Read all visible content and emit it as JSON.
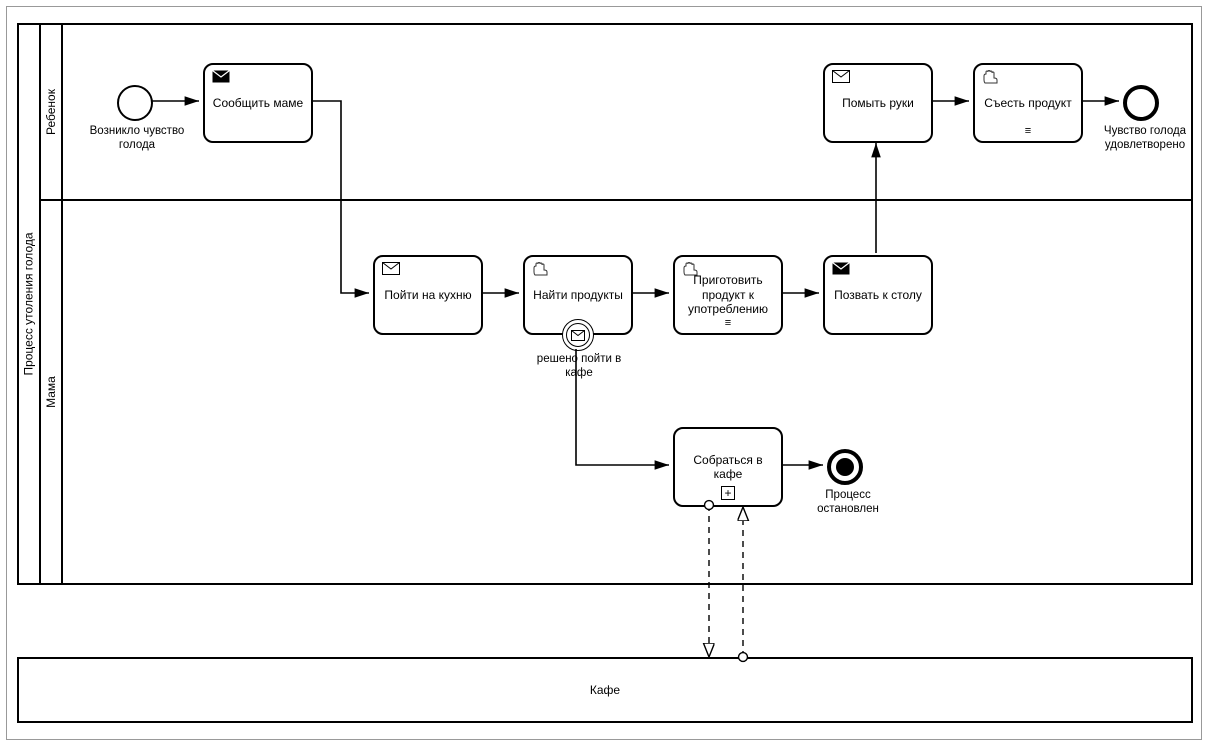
{
  "pool": {
    "title": "Процесс утоления голода",
    "lanes": {
      "child": "Ребенок",
      "mom": "Мама"
    }
  },
  "externalPool": "Кафе",
  "events": {
    "start": "Возникло чувство голода",
    "end": "Чувство голода удовлетворено",
    "terminate": "Процесс остановлен",
    "boundary": "решено пойти в кафе"
  },
  "tasks": {
    "tellMom": "Сообщить маме",
    "washHands": "Помыть руки",
    "eatProduct": "Съесть продукт",
    "goKitchen": "Пойти на кухню",
    "findProducts": "Найти продукты",
    "prepareProduct": "Приготовить продукт к употреблению",
    "callToTable": "Позвать к столу",
    "gatherCafe": "Собраться в кафе"
  }
}
